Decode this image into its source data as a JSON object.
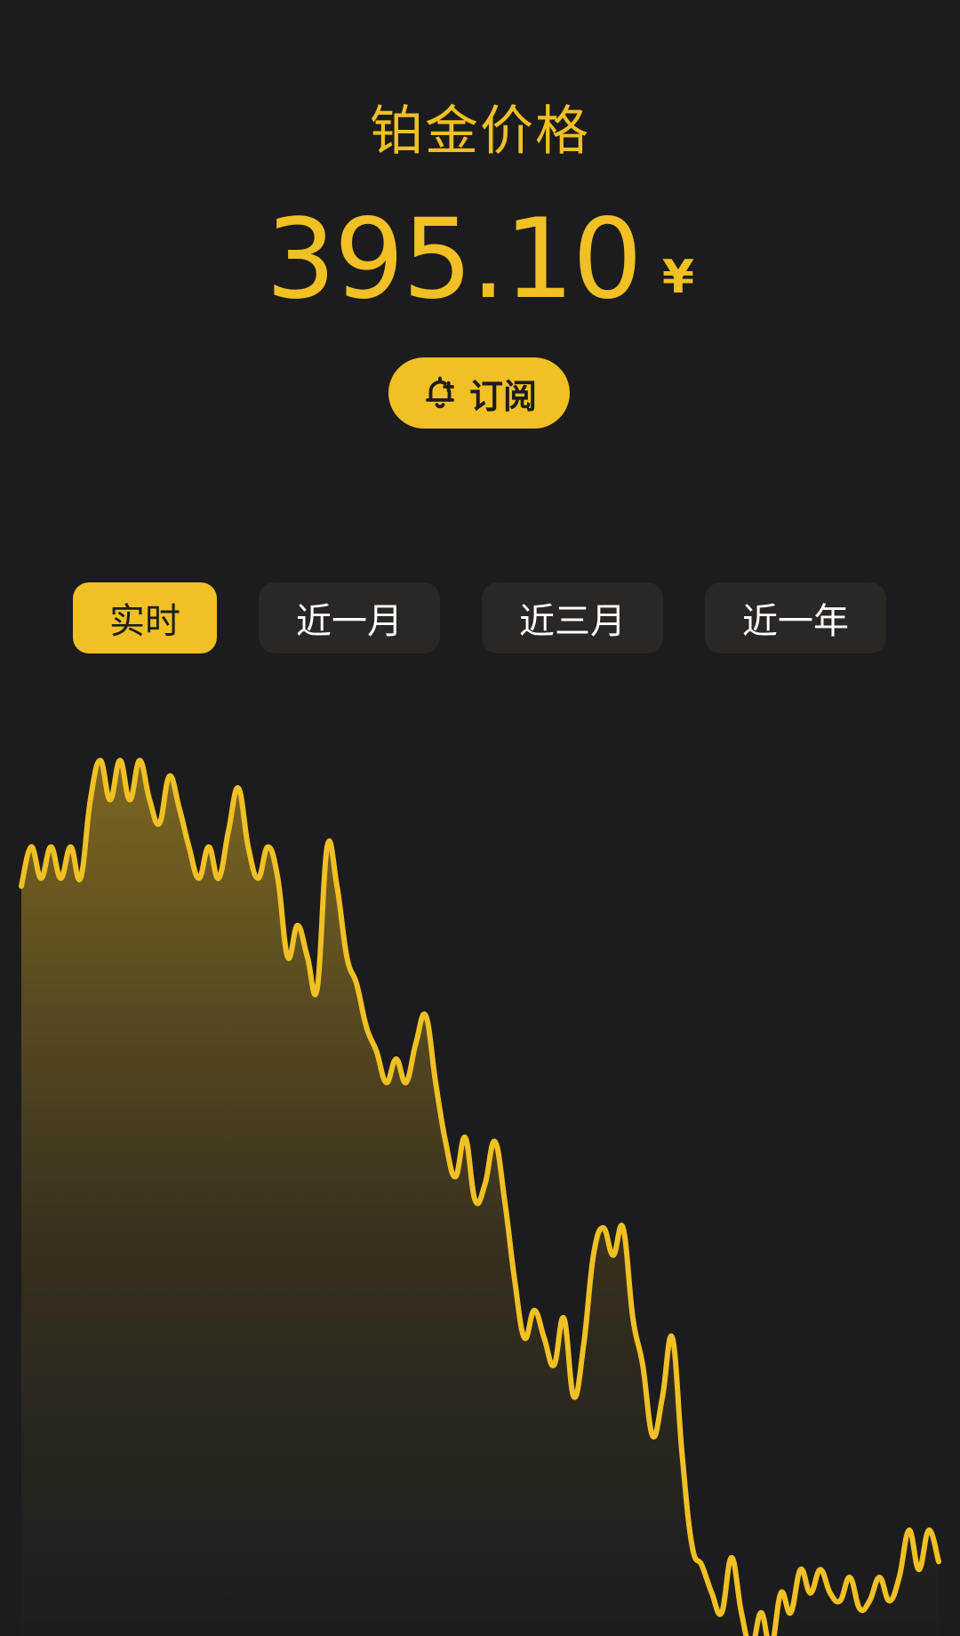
{
  "header": {
    "title": "铂金价格",
    "price": "395.10",
    "currency": "¥"
  },
  "subscribe": {
    "label": "订阅",
    "icon": "bell-plus-icon"
  },
  "tabs": [
    {
      "label": "实时",
      "active": true
    },
    {
      "label": "近一月",
      "active": false
    },
    {
      "label": "近三月",
      "active": false
    },
    {
      "label": "近一年",
      "active": false
    }
  ],
  "colors": {
    "background": "#1c1c1e",
    "accent": "#f0c024",
    "tab_inactive": "#2a2724",
    "tab_text": "#ffffff"
  },
  "chart_data": {
    "type": "area",
    "title": "",
    "xlabel": "",
    "ylabel": "",
    "grid": false,
    "values": [
      430,
      440,
      432,
      440,
      432,
      440,
      432,
      452,
      462,
      452,
      462,
      452,
      462,
      452,
      446,
      458,
      450,
      440,
      432,
      440,
      432,
      444,
      455,
      440,
      432,
      440,
      432,
      412,
      420,
      412,
      404,
      440,
      430,
      412,
      405,
      394,
      388,
      380,
      386,
      380,
      390,
      397,
      380,
      365,
      356,
      366,
      350,
      354,
      365,
      350,
      330,
      315,
      322,
      315,
      308,
      320,
      300,
      313,
      336,
      343,
      336,
      343,
      320,
      308,
      290,
      300,
      315,
      285,
      262,
      257,
      250,
      245,
      259,
      245,
      236,
      245,
      236,
      250,
      245,
      256,
      250,
      256,
      250,
      248,
      254,
      246,
      248,
      254,
      248,
      254,
      266,
      256,
      266,
      258
    ],
    "ylim": [
      230,
      470
    ]
  }
}
